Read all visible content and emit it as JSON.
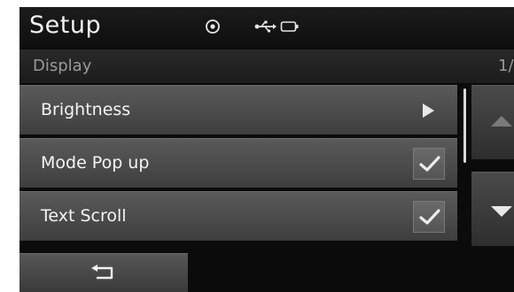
{
  "header": {
    "title": "Setup",
    "status_icons": [
      "disc-icon",
      "usb-icon",
      "battery-icon"
    ]
  },
  "subheader": {
    "section": "Display",
    "page_indicator": "1/"
  },
  "menu": {
    "items": [
      {
        "label": "Brightness",
        "control": "arrow"
      },
      {
        "label": "Mode Pop up",
        "control": "checkbox",
        "checked": true
      },
      {
        "label": "Text Scroll",
        "control": "checkbox",
        "checked": true
      }
    ]
  },
  "scrollbar": {
    "up_icon": "scroll-up-arrow-icon",
    "down_icon": "scroll-down-arrow-icon"
  },
  "footer": {
    "back_icon": "back-arrow-icon"
  },
  "colors": {
    "screen_bg": "#0b0b0b",
    "item_bg": "#4c4c4c",
    "text": "#f4f4f4",
    "muted_text": "#9a9a9a"
  }
}
